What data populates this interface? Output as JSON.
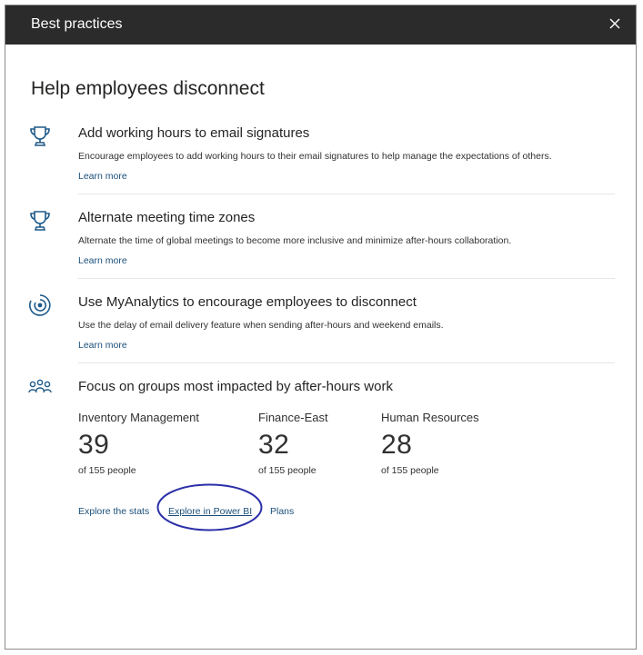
{
  "dialog": {
    "title": "Best practices",
    "close_icon": "close-icon"
  },
  "heading": "Help employees disconnect",
  "practices": [
    {
      "icon": "trophy-icon",
      "title": "Add working hours to email signatures",
      "description": "Encourage employees to add working hours to their email signatures to help manage the expectations of others.",
      "link": "Learn more"
    },
    {
      "icon": "trophy-icon",
      "title": "Alternate meeting time zones",
      "description": "Alternate the time of global meetings to become more inclusive and minimize after-hours collaboration.",
      "link": "Learn more"
    },
    {
      "icon": "myanalytics-icon",
      "title": "Use MyAnalytics to encourage employees to disconnect",
      "description": "Use the delay of email delivery feature when sending after-hours and weekend emails.",
      "link": "Learn more"
    }
  ],
  "focus": {
    "icon": "people-group-icon",
    "title": "Focus on groups most impacted by after-hours work",
    "groups": [
      {
        "name": "Inventory Management",
        "count": "39",
        "total": "of 155 people"
      },
      {
        "name": "Finance-East",
        "count": "32",
        "total": "of 155 people"
      },
      {
        "name": "Human Resources",
        "count": "28",
        "total": "of 155 people"
      }
    ],
    "links": {
      "explore_stats": "Explore the stats",
      "explore_power_bi": "Explore in Power BI",
      "plans": "Plans"
    }
  },
  "colors": {
    "titlebar": "#2b2b2b",
    "link": "#1a4f7a",
    "icon": "#1e5a8a",
    "annotation_ellipse": "#2b2fa8"
  }
}
